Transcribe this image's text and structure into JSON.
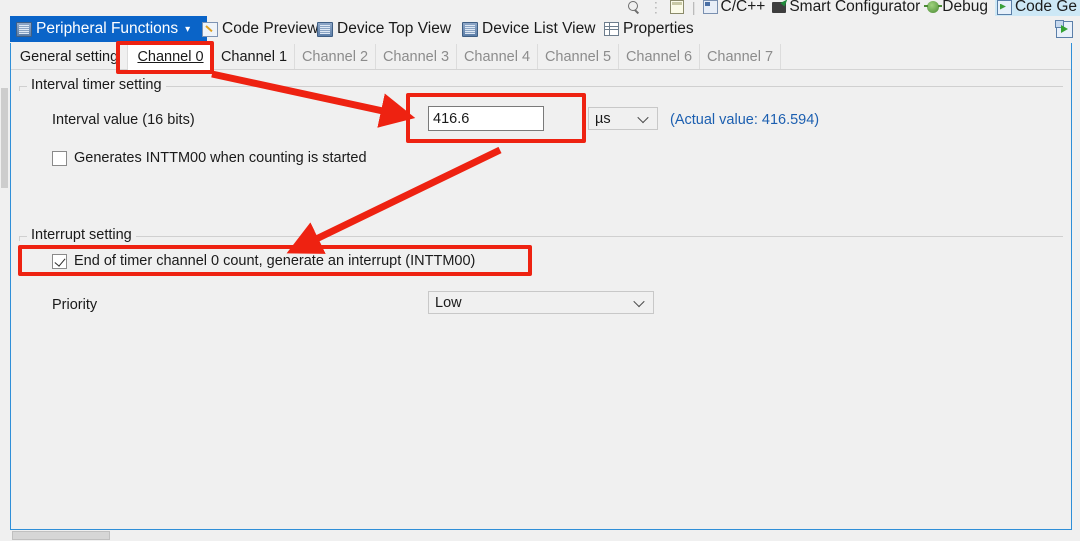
{
  "toolbar": {
    "search_icon": "search-icon",
    "perspective_icon": "perspective-layout-icon",
    "items": [
      {
        "label": "C/C++",
        "icon": "cpp-perspective-icon",
        "active": false
      },
      {
        "label": "Smart Configurator",
        "icon": "smart-configurator-icon",
        "active": false
      },
      {
        "label": "Debug",
        "icon": "debug-bug-icon",
        "active": false
      },
      {
        "label": "Code Ge",
        "icon": "code-generate-icon",
        "active": true
      }
    ]
  },
  "view_tabs": [
    {
      "label": "Peripheral Functions",
      "icon": "chip-icon",
      "active": true,
      "has_caret": true
    },
    {
      "label": "Code Preview",
      "icon": "pencil-edit-icon",
      "active": false,
      "has_caret": false
    },
    {
      "label": "Device Top View",
      "icon": "chip-icon",
      "active": false,
      "has_caret": false
    },
    {
      "label": "Device List View",
      "icon": "chip-icon",
      "active": false,
      "has_caret": false
    },
    {
      "label": "Properties",
      "icon": "properties-table-icon",
      "active": false,
      "has_caret": false
    }
  ],
  "generate_code_button": {
    "name": "generate-code-icon"
  },
  "channel_tabs": [
    {
      "label": "General setting",
      "state": "enabled"
    },
    {
      "label": "Channel 0",
      "state": "selected"
    },
    {
      "label": "Channel 1",
      "state": "enabled"
    },
    {
      "label": "Channel 2",
      "state": "disabled"
    },
    {
      "label": "Channel 3",
      "state": "disabled"
    },
    {
      "label": "Channel 4",
      "state": "disabled"
    },
    {
      "label": "Channel 5",
      "state": "disabled"
    },
    {
      "label": "Channel 6",
      "state": "disabled"
    },
    {
      "label": "Channel 7",
      "state": "disabled"
    }
  ],
  "interval_group": {
    "title": "Interval timer setting",
    "interval_label": "Interval value (16 bits)",
    "interval_value": "416.6",
    "unit_value": "µs",
    "actual_value": "(Actual value: 416.594)",
    "generates_checkbox": {
      "label": "Generates INTTM00 when counting is started",
      "checked": false
    }
  },
  "interrupt_group": {
    "title": "Interrupt setting",
    "end_of_count_checkbox": {
      "label": "End of timer channel 0 count, generate an interrupt (INTTM00)",
      "checked": true
    },
    "priority_label": "Priority",
    "priority_value": "Low"
  },
  "annotations": {
    "highlight_color": "#ee2211",
    "boxes": [
      "channel-0-tab",
      "interval-value-input",
      "end-of-count-checkbox"
    ],
    "arrows": [
      "channel-0-tab-to-interval-value",
      "interval-value-to-interrupt-checkbox"
    ]
  },
  "colors": {
    "accent_blue": "#0a64c8",
    "editor_border": "#2f8fd8",
    "link_blue": "#1c5fb0",
    "annotation_red": "#ee2211"
  }
}
